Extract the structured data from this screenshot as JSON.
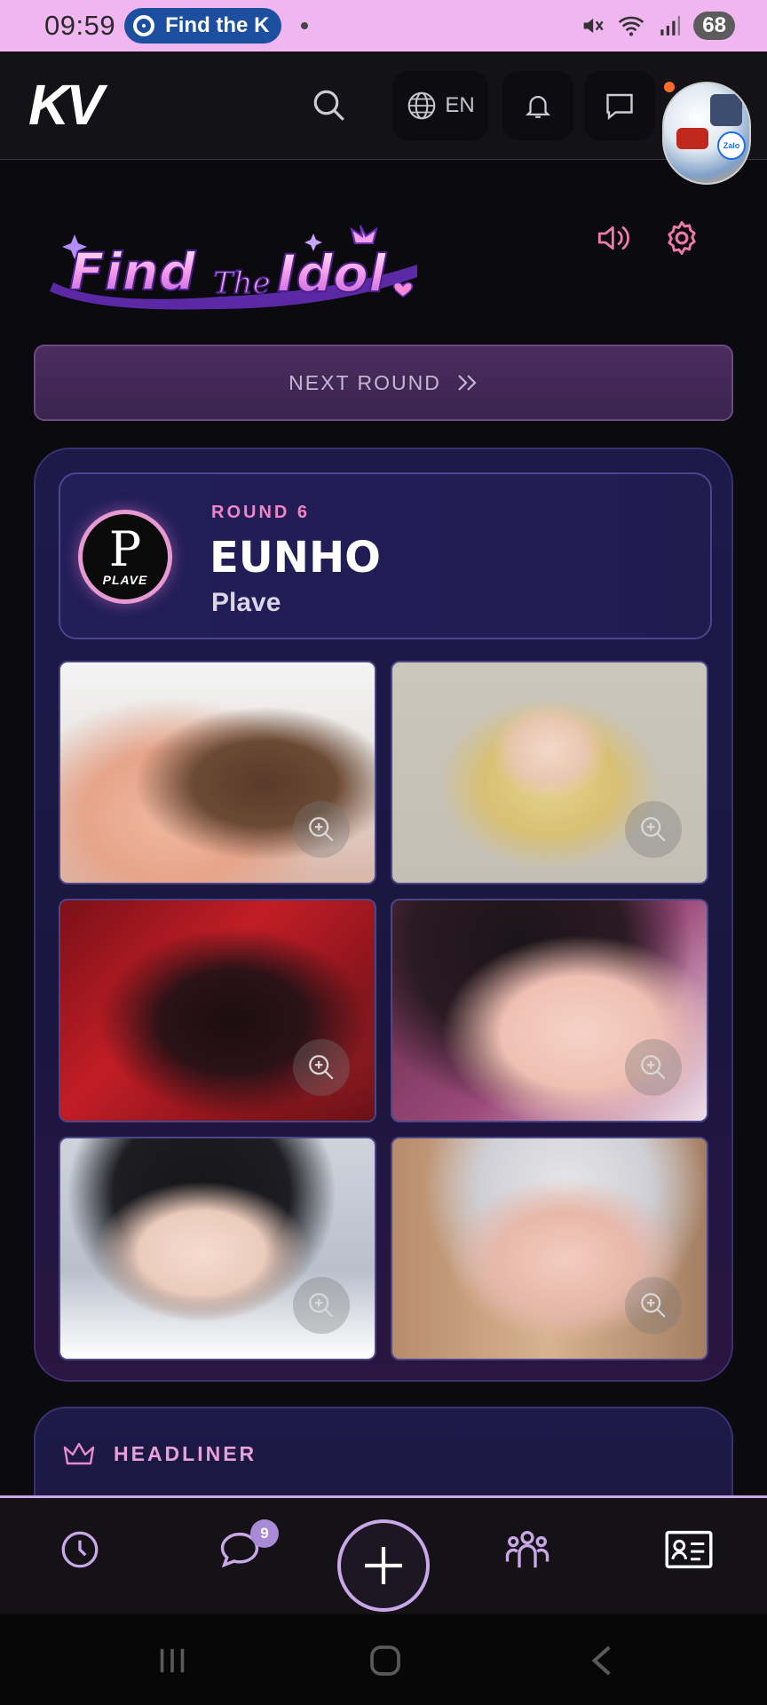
{
  "status_bar": {
    "time": "09:59",
    "pill_text": "Find the K",
    "battery": "68",
    "icons": [
      "chrome-icon",
      "mute-icon",
      "wifi-icon",
      "signal-icon"
    ]
  },
  "header": {
    "logo_text": "KV",
    "language": "EN",
    "icons": [
      "search-icon",
      "globe-icon",
      "bell-icon",
      "chat-icon"
    ],
    "avatar_badge": "Zalo"
  },
  "game": {
    "title_words": [
      "Find",
      "The",
      "Idol"
    ],
    "next_round_label": "NEXT ROUND",
    "round_label": "ROUND 6",
    "idol_name": "EUNHO",
    "group_name": "Plave",
    "group_logo_text": "PLAVE",
    "photos": [
      {
        "name": "photo-1"
      },
      {
        "name": "photo-2"
      },
      {
        "name": "photo-3"
      },
      {
        "name": "photo-4"
      },
      {
        "name": "photo-5"
      },
      {
        "name": "photo-6"
      }
    ]
  },
  "headliner": {
    "label": "HEADLINER"
  },
  "bottom_nav": {
    "items": [
      "history-icon",
      "messages-icon",
      "add-icon",
      "community-icon",
      "profile-card-icon"
    ],
    "messages_badge": "9"
  },
  "colors": {
    "accent_pink": "#ee86c6",
    "accent_lilac": "#c9a7e8",
    "status_bar_bg": "#f0b6f0",
    "card_bg": "#1d1a4a"
  }
}
